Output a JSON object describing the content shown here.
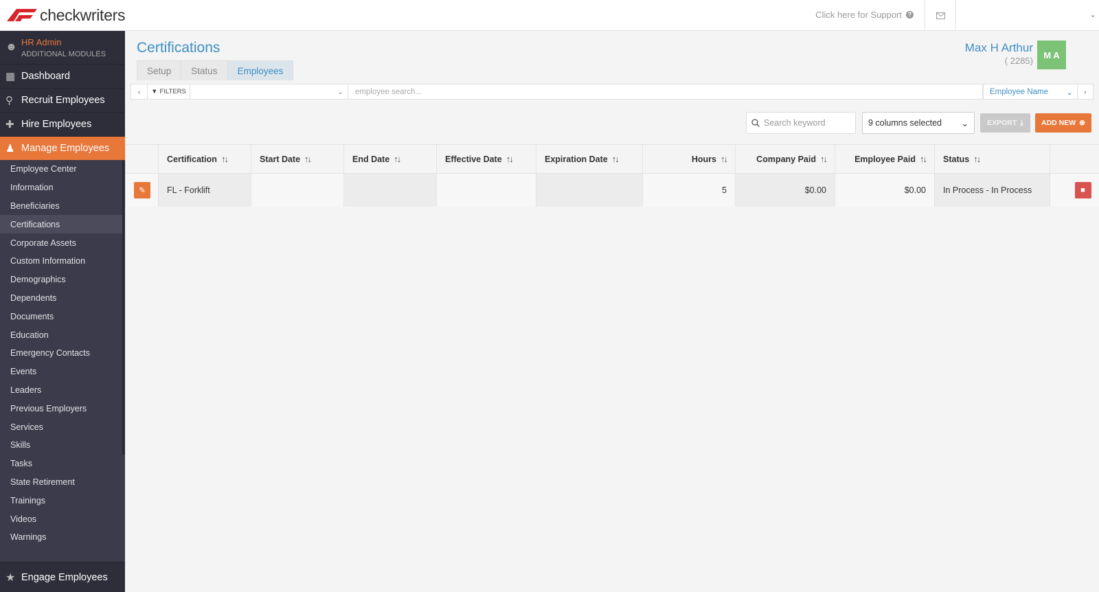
{
  "header": {
    "logo_text": "checkwriters",
    "support_label": "Click here for Support",
    "support_icon": "question-circle-icon",
    "mail_icon": "envelope-icon",
    "account_caret": "chevron-down-icon"
  },
  "sidebar": {
    "module": {
      "title": "HR Admin",
      "subtitle": "ADDITIONAL MODULES"
    },
    "main_items": [
      {
        "label": "Dashboard",
        "icon": "grid-icon"
      },
      {
        "label": "Recruit Employees",
        "icon": "search-person-icon"
      },
      {
        "label": "Hire Employees",
        "icon": "user-plus-icon"
      },
      {
        "label": "Manage Employees",
        "icon": "user-icon"
      }
    ],
    "sub_items": [
      "Employee Center",
      "Information",
      "Beneficiaries",
      "Certifications",
      "Corporate Assets",
      "Custom Information",
      "Demographics",
      "Dependents",
      "Documents",
      "Education",
      "Emergency Contacts",
      "Events",
      "Leaders",
      "Previous Employers",
      "Services",
      "Skills",
      "Tasks",
      "State Retirement",
      "Trainings",
      "Videos",
      "Warnings"
    ],
    "bottom_item": {
      "label": "Engage Employees",
      "icon": "star-icon"
    }
  },
  "page": {
    "title": "Certifications",
    "tabs": [
      {
        "label": "Setup"
      },
      {
        "label": "Status"
      },
      {
        "label": "Employees"
      }
    ]
  },
  "user": {
    "name": "Max H Arthur",
    "id": "( 2285)",
    "initials": "M A"
  },
  "filterbar": {
    "filters_label": "FILTERS",
    "search_placeholder": "employee search...",
    "name_select": "Employee Name"
  },
  "toolbar": {
    "keyword_placeholder": "Search keyword",
    "columns_selected": "9 columns selected",
    "export_label": "EXPORT",
    "add_label": "ADD NEW"
  },
  "table": {
    "columns": [
      "Certification",
      "Start Date",
      "End Date",
      "Effective Date",
      "Expiration Date",
      "Hours",
      "Company Paid",
      "Employee Paid",
      "Status"
    ],
    "rows": [
      {
        "certification": "FL - Forklift",
        "start_date": "",
        "end_date": "",
        "effective_date": "",
        "expiration_date": "",
        "hours": "5",
        "company_paid": "$0.00",
        "employee_paid": "$0.00",
        "status": "In Process - In Process"
      }
    ]
  },
  "colors": {
    "accent_orange": "#e8773a",
    "link_blue": "#3d8fc4",
    "sidebar_bg": "#3b3b4b",
    "avatar_green": "#7cc377",
    "delete_red": "#d9534f"
  }
}
